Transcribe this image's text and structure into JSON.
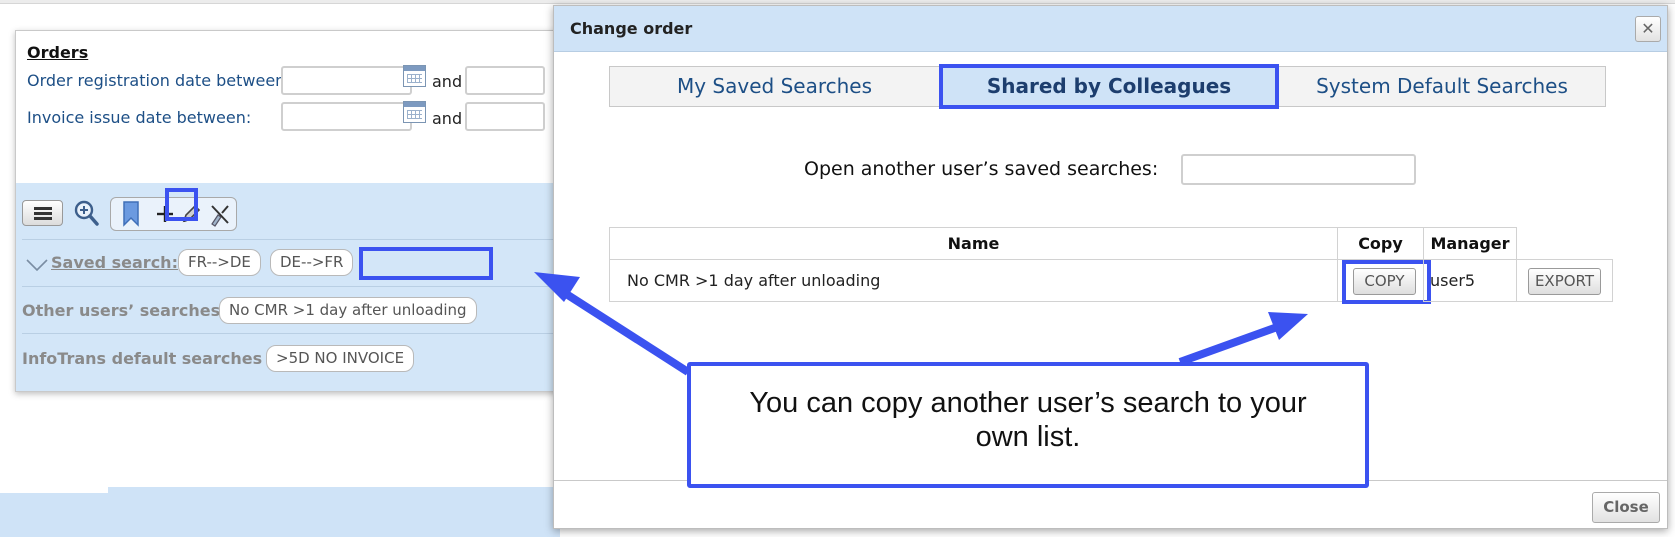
{
  "left_panel": {
    "title": "Orders",
    "order_reg_label": "Order registration date between:",
    "invoice_label": "Invoice issue date between:",
    "and_label": "and",
    "saved_search_label": "Saved search:",
    "saved_search_chips": [
      "FR-->DE",
      "DE-->FR"
    ],
    "other_users_label": "Other users’ searches",
    "other_users_chip": "No CMR >1 day after unloading",
    "default_label": "InfoTrans default searches",
    "default_chip": ">5D NO INVOICE"
  },
  "dialog": {
    "title": "Change order",
    "close_x": "✕",
    "tabs": [
      {
        "label": "My Saved Searches",
        "active": false
      },
      {
        "label": "Shared by Colleagues",
        "active": true
      },
      {
        "label": "System Default Searches",
        "active": false
      }
    ],
    "open_label": "Open another user’s saved searches:",
    "open_input_value": "",
    "table": {
      "headers": [
        "Name",
        "Copy",
        "Manager"
      ],
      "rows": [
        {
          "name": "No CMR >1 day after unloading",
          "copy_label": "COPY",
          "manager": "user5",
          "export_label": "EXPORT"
        }
      ]
    },
    "close_button": "Close"
  },
  "callout": {
    "text": "You can copy another user’s search to your own list."
  },
  "colors": {
    "highlight": "#3b52f0",
    "panel_blue": "#cfe3f7",
    "link_blue": "#1d4f86"
  }
}
